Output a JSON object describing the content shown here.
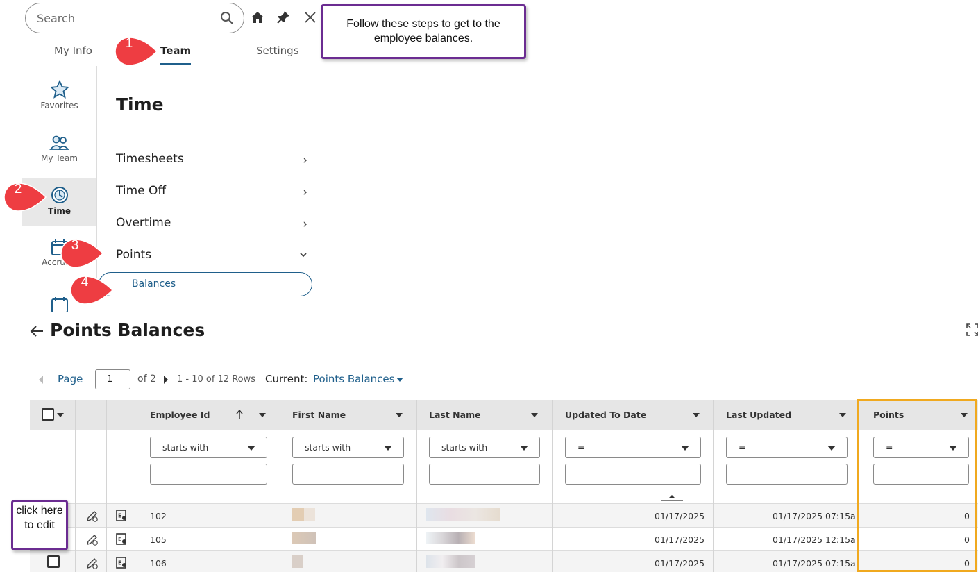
{
  "search": {
    "placeholder": "Search"
  },
  "menu_tabs": [
    {
      "label": "My Info"
    },
    {
      "label": "Team"
    },
    {
      "label": "Settings"
    }
  ],
  "rail": {
    "favorites": "Favorites",
    "my_team": "My Team",
    "time": "Time",
    "accruals": "Accruals"
  },
  "time_menu": {
    "title": "Time",
    "items": [
      {
        "label": "Timesheets"
      },
      {
        "label": "Time Off"
      },
      {
        "label": "Overtime"
      },
      {
        "label": "Points"
      }
    ],
    "sub_item": "Balances"
  },
  "instruction": "Follow these steps to get to the employee balances.",
  "steps": [
    "1",
    "2",
    "3",
    "4"
  ],
  "page": {
    "title": "Points Balances"
  },
  "pager": {
    "page_label": "Page",
    "page_value": "1",
    "of_label": "of 2",
    "rows_label": "1 - 10 of 12 Rows",
    "current_label": "Current:",
    "current_view": "Points Balances"
  },
  "grid": {
    "columns": [
      {
        "label": "Employee Id",
        "filter_op": "starts with"
      },
      {
        "label": "First Name",
        "filter_op": "starts with"
      },
      {
        "label": "Last Name",
        "filter_op": "starts with"
      },
      {
        "label": "Updated To Date",
        "filter_op": "="
      },
      {
        "label": "Last Updated",
        "filter_op": "="
      },
      {
        "label": "Points",
        "filter_op": "="
      }
    ],
    "rows": [
      {
        "employee_id": "102",
        "updated_to_date": "01/17/2025",
        "last_updated": "01/17/2025 07:15a",
        "points": "0"
      },
      {
        "employee_id": "105",
        "updated_to_date": "01/17/2025",
        "last_updated": "01/17/2025 12:15a",
        "points": "0"
      },
      {
        "employee_id": "106",
        "updated_to_date": "01/17/2025",
        "last_updated": "01/17/2025 07:15a",
        "points": "0"
      }
    ]
  },
  "click_note": "click here to edit",
  "colors": {
    "accent": "#1f5f8b",
    "callout_border": "#6b2c91",
    "step_badge": "#ee3d42",
    "highlight": "#f0a91f"
  }
}
